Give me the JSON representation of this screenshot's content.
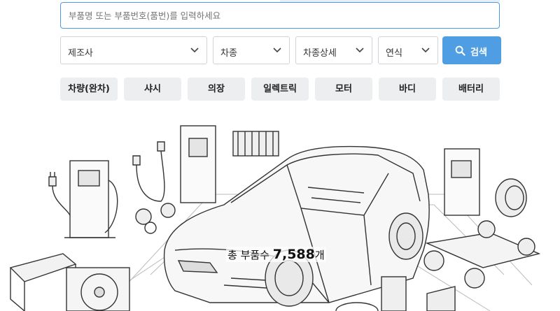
{
  "search": {
    "placeholder": "부품명 또는 부품번호(품번)를 입력하세요"
  },
  "filters": [
    {
      "label": "제조사"
    },
    {
      "label": "차종"
    },
    {
      "label": "차종상세"
    },
    {
      "label": "연식"
    }
  ],
  "search_button": {
    "label": "검색",
    "icon": "search-icon"
  },
  "categories": [
    "차량(완차)",
    "샤시",
    "의장",
    "일렉트릭",
    "모터",
    "바디",
    "배터리"
  ],
  "total": {
    "prefix": "총 부품수",
    "count": "7,588",
    "unit": "개"
  },
  "colors": {
    "accent": "#4f9ee3",
    "border_active": "#4a9be8",
    "chip_bg": "#eceef0"
  }
}
